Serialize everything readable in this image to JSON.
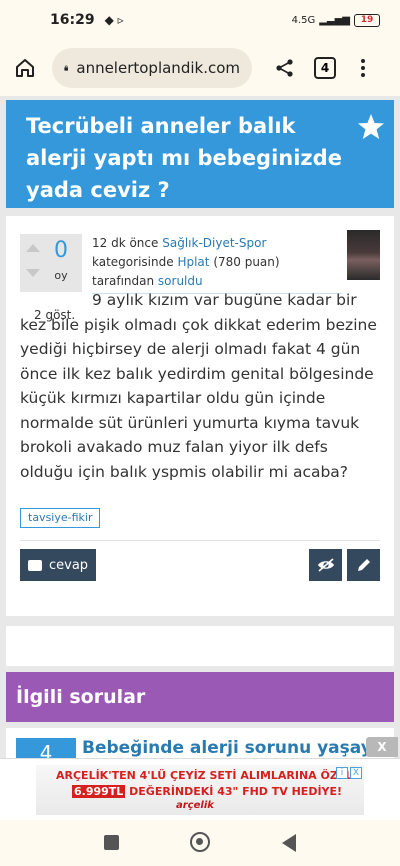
{
  "status_bar": {
    "time": "16:29",
    "network": "4.5G",
    "battery": "19"
  },
  "browser": {
    "url": "annelertoplandik.com",
    "tab_count": "4"
  },
  "question": {
    "title": "Tecrübeli anneler balık alerji yaptı mı bebeginizde yada ceviz ?",
    "votes": "0",
    "votes_label": "oy",
    "views": "2 göst.",
    "meta": {
      "time": "12 dk önce",
      "category": "Sağlık-Diyet-Spor",
      "category_suffix": "kategorisinde",
      "user": "Hplat",
      "points": "(780 puan)",
      "by": "tarafından",
      "action": "soruldu"
    },
    "body": "9 aylık kızım var bugüne kadar bir kez bile pişik olmadı çok dikkat ederim bezine yediği hiçbirsey de alerji olmadı fakat 4 gün önce ilk kez balık yedirdim genital bölgesinde küçük kırmızı kapartilar oldu gün içinde normalde süt ürünleri yumurta kıyma tavuk brokoli avakado muz falan yiyor ilk defs olduğu için balık yspmis olabilir mi acaba?",
    "tag": "tavsiye-fikir",
    "reply_label": "cevap"
  },
  "related": {
    "heading": "İlgili sorular",
    "items": [
      {
        "count": "4",
        "title": "Bebeğinde alerji sorunu yaşayan"
      }
    ]
  },
  "ad": {
    "close": "X",
    "line1": "ARÇELİK'TEN 4'LÜ ÇEYİZ SETİ ALIMLARINA ÖZEL",
    "price": "6.999TL",
    "line2": "DEĞERİNDEKİ 43\" FHD TV HEDİYE!",
    "brand": "arçelik",
    "info": "i",
    "x": "X"
  },
  "colors": {
    "accent": "#3498db",
    "related": "#9b59b6",
    "button": "#34495e"
  }
}
